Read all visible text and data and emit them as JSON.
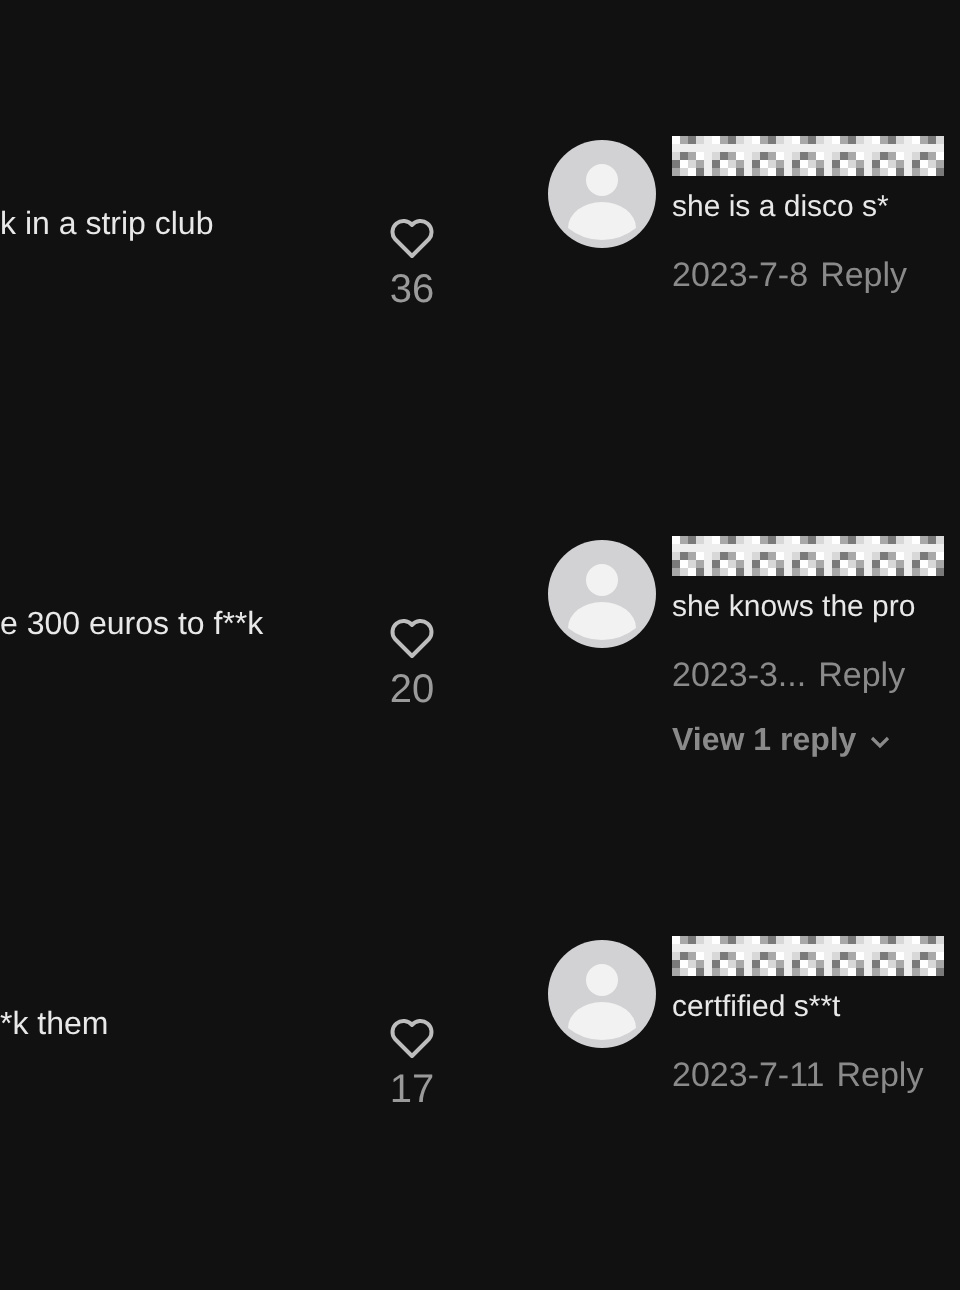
{
  "comments": [
    {
      "left_text": "k in a strip club",
      "likes": "36",
      "right_text": "she is a disco s*",
      "date": "2023-7-8",
      "reply": "Reply"
    },
    {
      "left_text": "e 300 euros to f**k",
      "likes": "20",
      "right_text": "she knows the pro",
      "date": "2023-3...",
      "reply": "Reply",
      "view_replies": "View 1 reply"
    },
    {
      "left_text": "*k them",
      "likes": "17",
      "right_text": "certfified s**t",
      "date": "2023-7-11",
      "reply": "Reply"
    }
  ]
}
